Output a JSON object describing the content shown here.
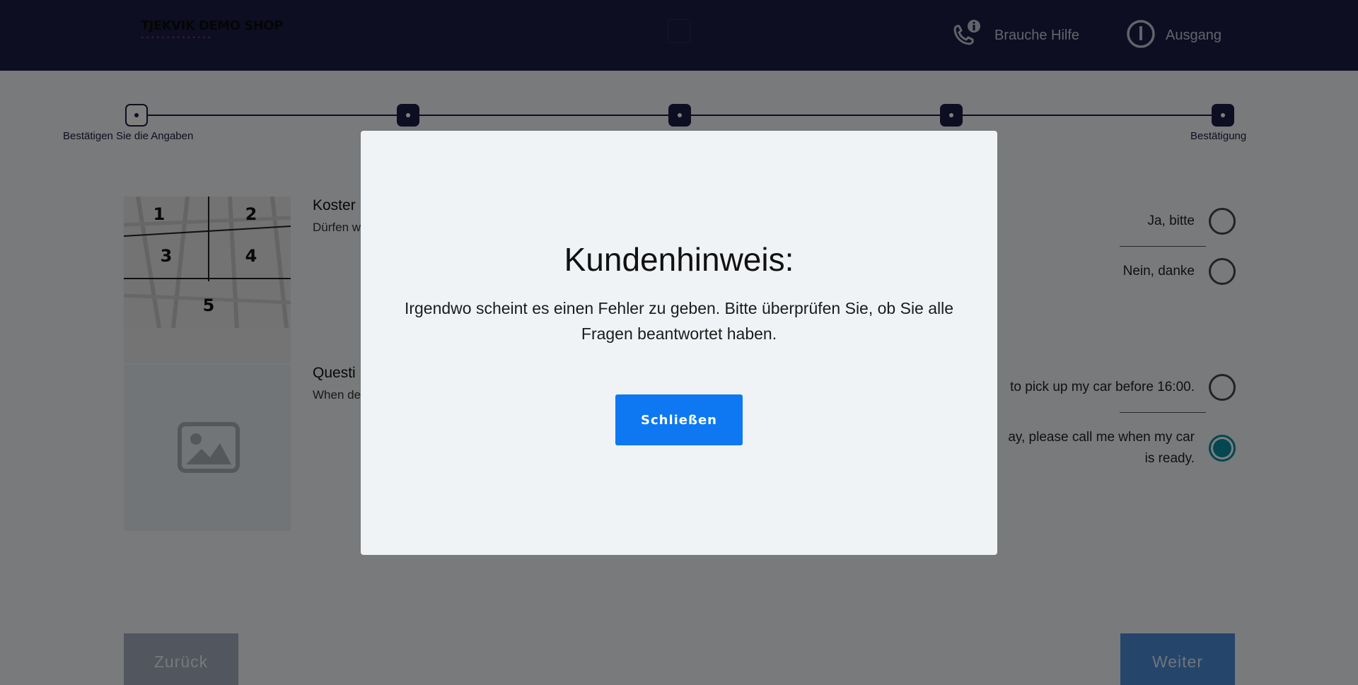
{
  "header": {
    "logo_title": "TJEKVIK DEMO SHOP",
    "logo_tagline": "• • • • • • • • • • • • • •",
    "help_label": "Brauche Hilfe",
    "exit_label": "Ausgang"
  },
  "stepper": {
    "first_label": "Bestätigen Sie die Angaben",
    "last_label": "Bestätigung",
    "current_step": 1,
    "total_steps": 5
  },
  "questions": [
    {
      "title": "Koster",
      "subtitle": "Dürfen w",
      "options": [
        {
          "label": "Ja, bitte",
          "selected": false
        },
        {
          "label": "Nein, danke",
          "selected": false
        }
      ]
    },
    {
      "title": "Questi",
      "subtitle": "When de",
      "options": [
        {
          "label": "to pick up my car before 16:00.",
          "selected": false
        },
        {
          "label": "ay, please call me when my car",
          "label_line2": "is ready.",
          "selected": true
        }
      ]
    }
  ],
  "grid_image_numbers": [
    "1",
    "2",
    "3",
    "4",
    "5"
  ],
  "footer": {
    "back_label": "Zurück",
    "next_label": "Weiter"
  },
  "modal": {
    "title": "Kundenhinweis:",
    "message": "Irgendwo scheint es einen Fehler zu geben. Bitte überprüfen Sie, ob Sie alle Fragen beantwortet haben.",
    "button_label": "Schließen"
  },
  "colors": {
    "header_bg": "#1d1d45",
    "primary_button": "#0d78f2",
    "selected_radio": "#0b8fa0"
  }
}
